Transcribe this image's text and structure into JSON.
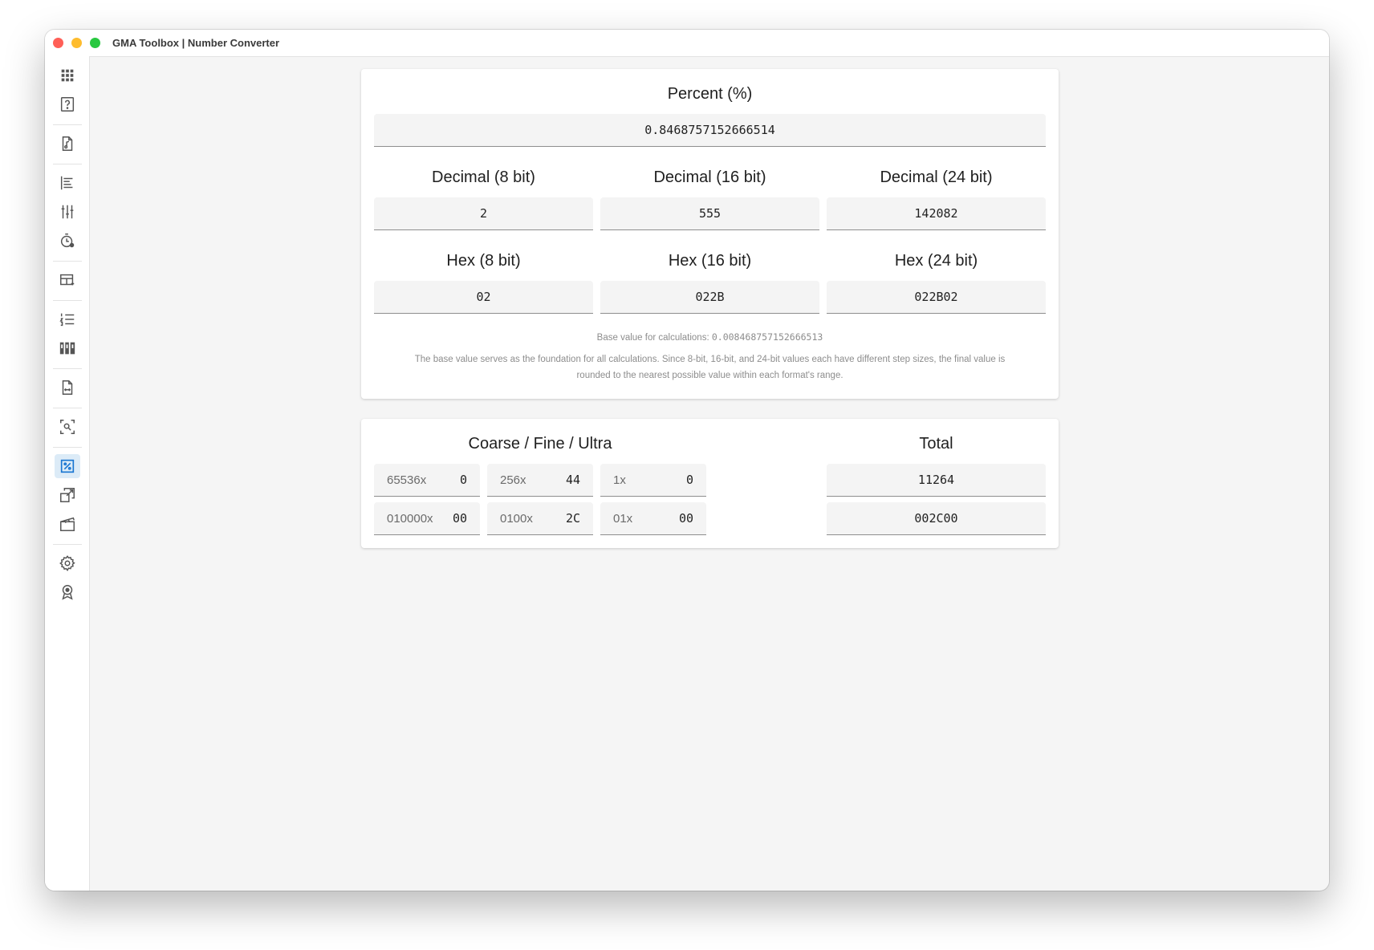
{
  "window": {
    "title": "GMA Toolbox | Number Converter"
  },
  "sidebar": {
    "items": [
      {
        "icon": "apps-grid-icon"
      },
      {
        "icon": "help-icon"
      },
      {
        "icon": "music-file-icon"
      },
      {
        "icon": "align-left-icon"
      },
      {
        "icon": "sliders-icon"
      },
      {
        "icon": "timer-icon"
      },
      {
        "icon": "table-edit-icon"
      },
      {
        "icon": "numbered-list-icon"
      },
      {
        "icon": "library-icon"
      },
      {
        "icon": "file-code-icon"
      },
      {
        "icon": "image-search-icon"
      },
      {
        "icon": "percent-icon"
      },
      {
        "icon": "open-external-icon"
      },
      {
        "icon": "clapperboard-icon"
      },
      {
        "icon": "settings-icon"
      },
      {
        "icon": "award-icon"
      }
    ],
    "active_icon": "percent-icon",
    "accent": "#1976d2"
  },
  "converter": {
    "percent_label": "Percent (%)",
    "percent_value": "0.8468757152666514",
    "decimal_8_label": "Decimal (8 bit)",
    "decimal_8_value": "2",
    "decimal_16_label": "Decimal (16 bit)",
    "decimal_16_value": "555",
    "decimal_24_label": "Decimal (24 bit)",
    "decimal_24_value": "142082",
    "hex_8_label": "Hex (8 bit)",
    "hex_8_value": "02",
    "hex_16_label": "Hex (16 bit)",
    "hex_16_value": "022B",
    "hex_24_label": "Hex (24 bit)",
    "hex_24_value": "022B02",
    "base_value_prefix": "Base value for calculations:",
    "base_value": "0.008468757152666513",
    "note_line1": "The base value serves as the foundation for all calculations. Since 8-bit, 16-bit, and 24-bit values each have different step sizes, the final value is",
    "note_line2": "rounded to the nearest possible value within each format's range."
  },
  "coarse_fine": {
    "heading": "Coarse / Fine / Ultra",
    "decimal_row": [
      {
        "label": "65536x",
        "value": "0"
      },
      {
        "label": "256x",
        "value": "44"
      },
      {
        "label": "1x",
        "value": "0"
      }
    ],
    "hex_row": [
      {
        "label": "010000x",
        "value": "00"
      },
      {
        "label": "0100x",
        "value": "2C"
      },
      {
        "label": "01x",
        "value": "00"
      }
    ],
    "total_heading": "Total",
    "total_decimal": "11264",
    "total_hex": "002C00"
  }
}
